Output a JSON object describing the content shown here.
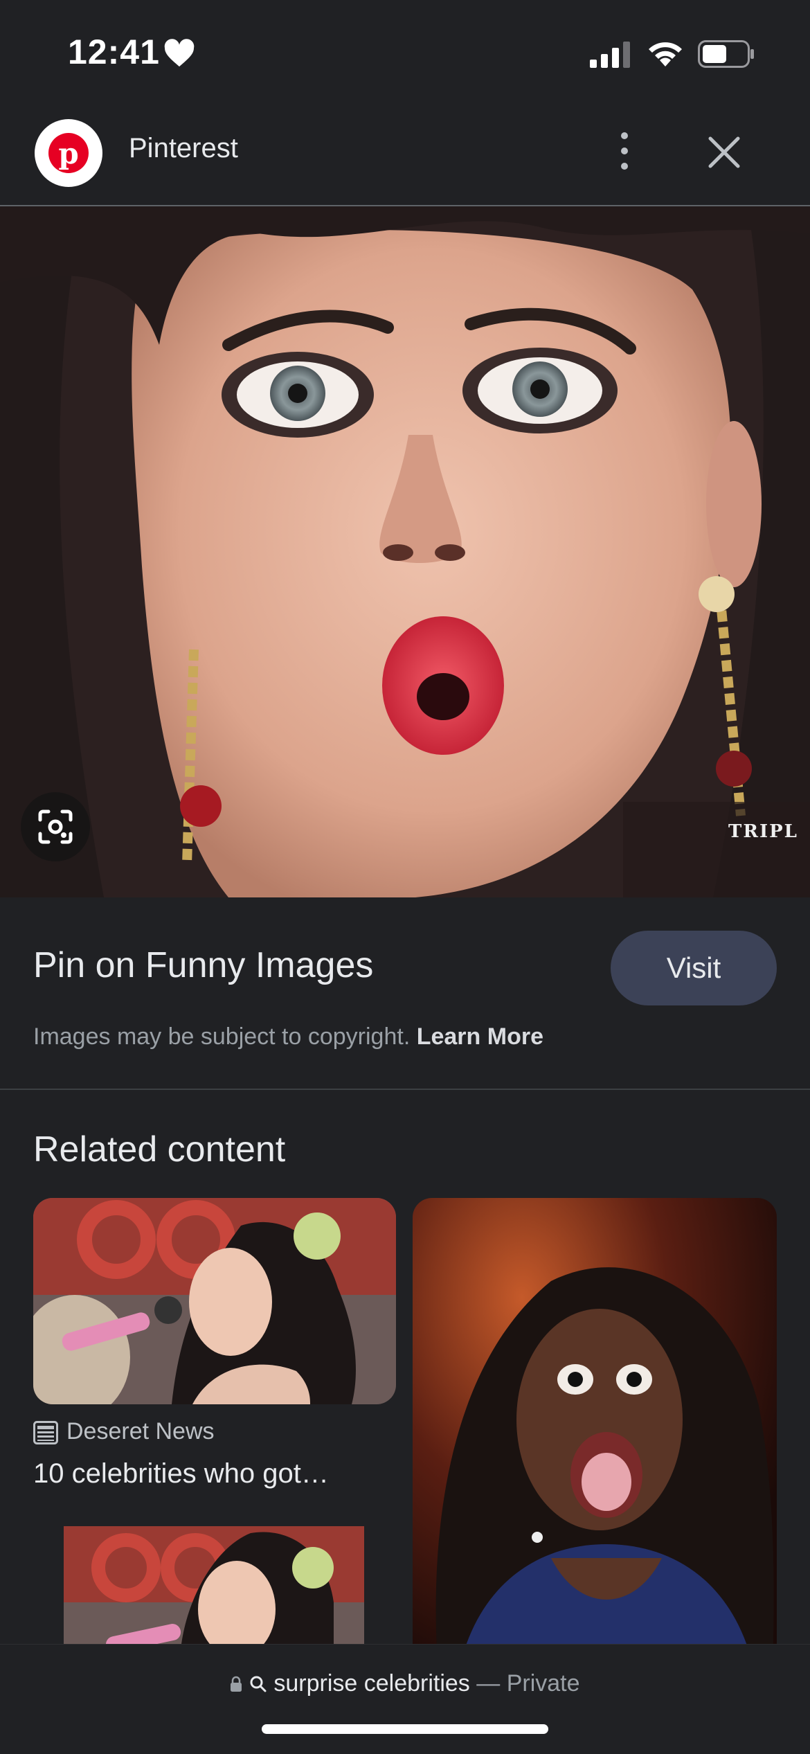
{
  "status_bar": {
    "time": "12:41",
    "icons": [
      "heart-icon",
      "signal-icon",
      "wifi-icon",
      "battery-icon"
    ]
  },
  "header": {
    "site_name": "Pinterest",
    "site_icon": "pinterest-logo",
    "accent": "#e60023",
    "more_icon": "more-vertical-icon",
    "close_icon": "close-icon"
  },
  "main_image": {
    "watermark": "TRIPL",
    "lens_icon": "lens-icon"
  },
  "info": {
    "title": "Pin on Funny Images",
    "visit_label": "Visit",
    "copyright_text": "Images may be subject to copyright.",
    "learn_more": "Learn More"
  },
  "related": {
    "heading": "Related content",
    "cards": [
      {
        "source": "Deseret News",
        "title": "10 celebrities who got…",
        "source_icon": "news-icon"
      }
    ]
  },
  "bottom": {
    "query": "surprise celebrities",
    "separator": "—",
    "privacy": "Private",
    "icons": [
      "lock-icon",
      "search-icon"
    ]
  }
}
